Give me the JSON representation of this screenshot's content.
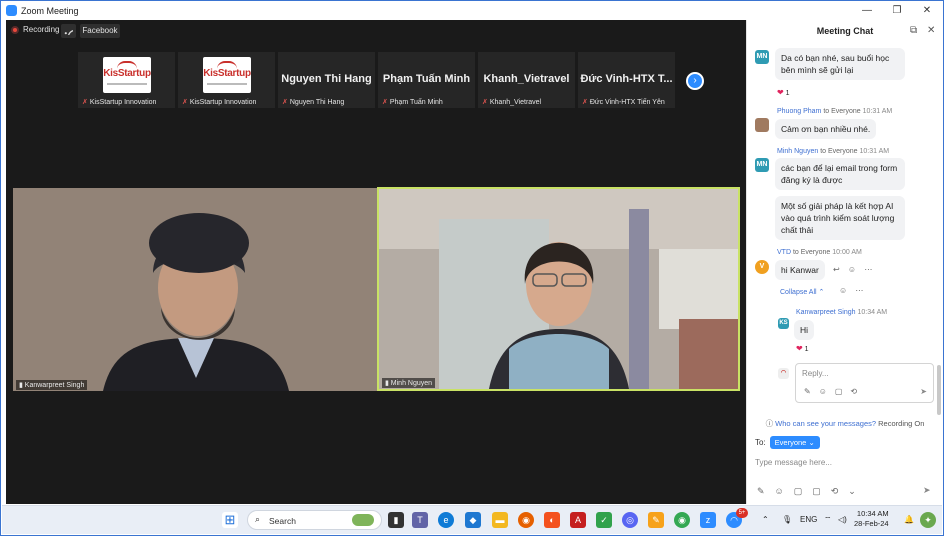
{
  "window": {
    "title": "Zoom Meeting",
    "controls": [
      "—",
      "❐",
      "✕"
    ]
  },
  "toolbar": {
    "recording_label": "Recording",
    "facebook_label": "Facebook"
  },
  "gallery": [
    {
      "type": "logo",
      "logo_text": "KisStartup",
      "name": "KisStartup Innovation"
    },
    {
      "type": "logo",
      "logo_text": "KisStartup",
      "name": "KisStartup Innovation"
    },
    {
      "type": "name",
      "display": "Nguyen Thi Hang",
      "name": "Nguyen Thi Hang"
    },
    {
      "type": "name",
      "display": "Phạm Tuấn Minh",
      "name": "Phạm Tuấn Minh"
    },
    {
      "type": "name",
      "display": "Khanh_Vietravel",
      "name": "Khanh_Vietravel"
    },
    {
      "type": "name",
      "display": "Đức Vinh-HTX T...",
      "name": "Đức Vinh-HTX Tiến Yên"
    }
  ],
  "videos": {
    "left_name": "Kanwarpreet Singh",
    "right_name": "Minh Nguyen"
  },
  "chat": {
    "title": "Meeting Chat",
    "messages": [
      {
        "avatar": "MN",
        "text": "Da có bạn nhé, sau buổi học bên mình sẽ gửi lại",
        "reaction": "1"
      },
      {
        "sender": "Phuong Pham",
        "to": "to Everyone",
        "time": "10:31 AM",
        "text": "Cảm ơn bạn nhiều nhé."
      },
      {
        "avatar": "MN",
        "sender": "Minh Nguyen",
        "to": "to Everyone",
        "time": "10:31 AM",
        "text": "các bạn để lại email trong form đăng ký là được"
      },
      {
        "text": "Một số giải pháp là kết hợp AI vào quá trình kiểm soát lượng chất thải"
      },
      {
        "avatar": "V",
        "sender": "VTD",
        "to": "to Everyone",
        "time": "10:00 AM",
        "text": "hi Kanwar"
      },
      {
        "avatar": "KS",
        "sender": "Kanwarpreet Singh",
        "time": "10:34 AM",
        "text": "Hi",
        "reaction": "1"
      }
    ],
    "collapse_label": "Collapse All",
    "reply_placeholder": "Reply...",
    "who_can_see": "Who can see your messages?",
    "recording_on": "Recording On",
    "to_label": "To:",
    "to_value": "Everyone",
    "input_placeholder": "Type message here..."
  },
  "taskbar": {
    "search_label": "Search",
    "lang": "ENG",
    "time": "10:34 AM",
    "date": "28-Feb-24",
    "badge": "5+"
  }
}
